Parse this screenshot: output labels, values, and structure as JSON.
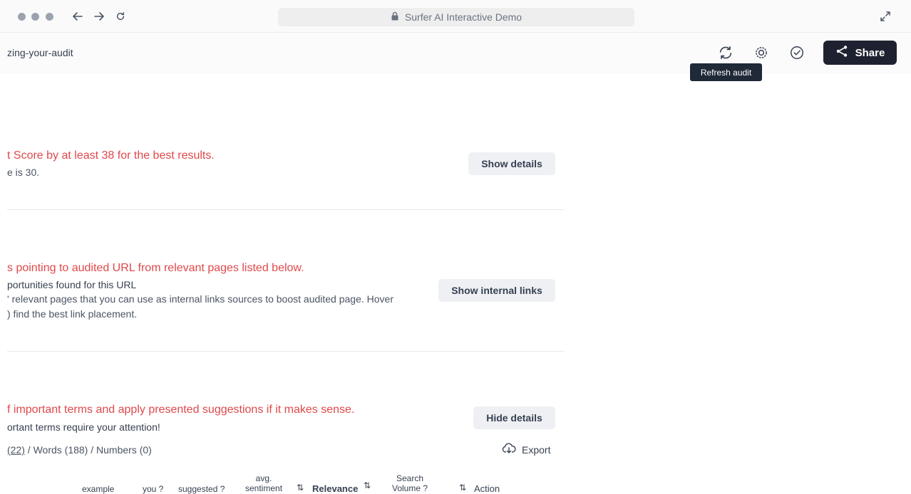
{
  "browser": {
    "url": "Surfer AI Interactive Demo",
    "icons": [
      "back-arrow-icon",
      "forward-arrow-icon",
      "reload-icon",
      "lock-icon",
      "expand-icon"
    ]
  },
  "header": {
    "slug": "zing-your-audit",
    "tooltip": "Refresh audit",
    "share_label": "Share",
    "icons": [
      "refresh-icon",
      "settings-icon",
      "check-circle-icon",
      "share-icon"
    ]
  },
  "sections": [
    {
      "title": "t Score by at least 38 for the best results.",
      "lines": [
        "e is 30."
      ],
      "button": "Show details"
    },
    {
      "title": "s pointing to audited URL from relevant pages listed below.",
      "lines": [
        "portunities found for this URL",
        "' relevant pages that you can use as internal links sources to boost audited page. Hover",
        ") find the best link placement."
      ],
      "button": "Show internal links"
    },
    {
      "title": "f important terms and apply presented suggestions if it makes sense.",
      "lines": [
        "ortant terms require your attention!"
      ],
      "button": "Hide details"
    }
  ],
  "term_tabs": {
    "first": "(22)",
    "rest": " / Words (188) / Numbers (0)"
  },
  "export_label": "Export",
  "table_headers": {
    "example": "example",
    "you": "you ?",
    "suggested": "suggested ?",
    "sentiment_1": "avg.",
    "sentiment_2": "sentiment",
    "relevance": "Relevance",
    "volume_1": "Search",
    "volume_2": "Volume ?",
    "action": "Action",
    "sort_glyph": "⇅"
  }
}
